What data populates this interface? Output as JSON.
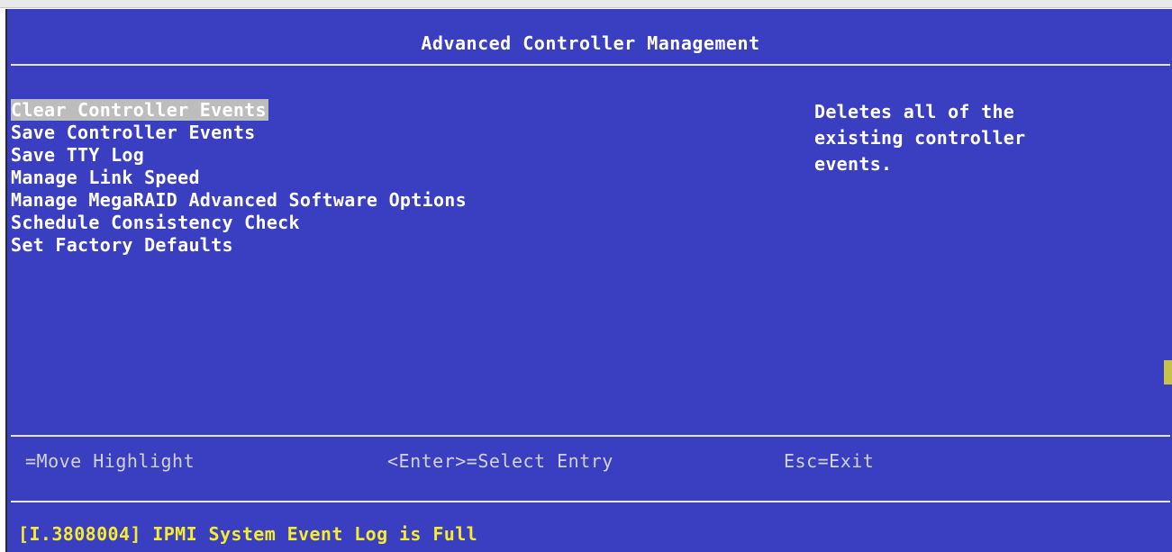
{
  "header": {
    "title": "Advanced Controller Management"
  },
  "menu": {
    "items": [
      {
        "label": "Clear Controller Events",
        "selected": true
      },
      {
        "label": "Save Controller Events",
        "selected": false
      },
      {
        "label": "Save TTY Log",
        "selected": false
      },
      {
        "label": "Manage Link Speed",
        "selected": false
      },
      {
        "label": "Manage MegaRAID Advanced Software Options",
        "selected": false
      },
      {
        "label": "Schedule Consistency Check",
        "selected": false
      },
      {
        "label": "Set Factory Defaults",
        "selected": false
      }
    ]
  },
  "help": {
    "lines": [
      "Deletes all of the",
      "existing controller",
      "events."
    ]
  },
  "footer": {
    "hints": {
      "move": "=Move Highlight",
      "select": "<Enter>=Select Entry",
      "exit": "Esc=Exit"
    },
    "status": "[I.3808004] IPMI System Event Log is Full"
  },
  "colors": {
    "background": "#3a3fc2",
    "text": "#ffffff",
    "highlight": "#bdbdbd",
    "status_text": "#f5ec2f",
    "hint_text": "#d2d2dc",
    "scroll_marker": "#c7c24a"
  }
}
